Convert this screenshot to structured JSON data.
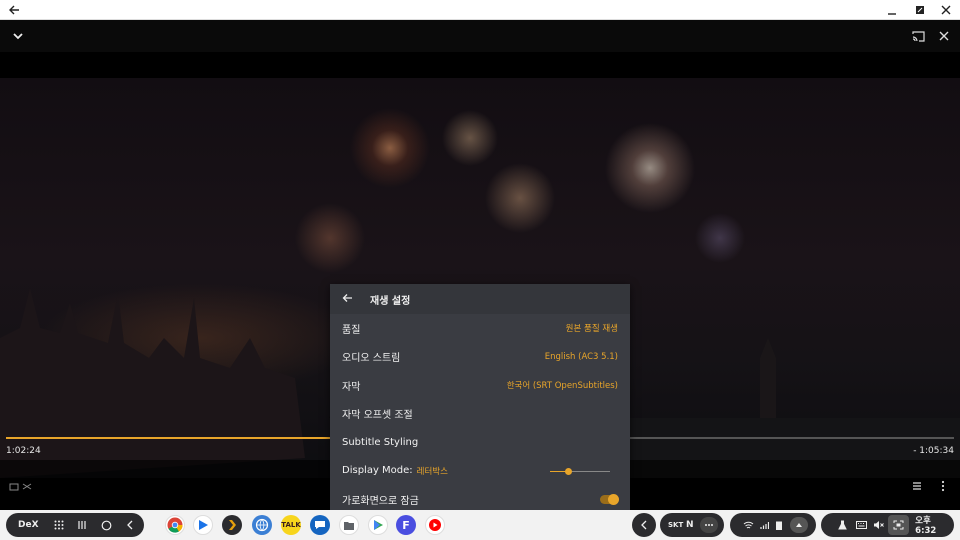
{
  "window": {
    "back_icon": "arrow-left-icon",
    "minimize_icon": "minimize-icon",
    "resize_icon": "resize-icon",
    "close_icon": "close-icon"
  },
  "player": {
    "collapse_icon": "chevron-down-icon",
    "cast_icon": "cast-icon",
    "close_icon": "close-icon",
    "elapsed": "1:02:24",
    "remaining": "- 1:05:34",
    "progress": 0.49,
    "accent": "#e8a52a"
  },
  "settings": {
    "title": "재생 설정",
    "rows": [
      {
        "label": "품질",
        "value": "원본 품질 재생"
      },
      {
        "label": "오디오 스트림",
        "value": "English (AC3 5.1)"
      },
      {
        "label": "자막",
        "value": "한국어 (SRT OpenSubtitles)"
      },
      {
        "label": "자막 오프셋 조절",
        "value": ""
      },
      {
        "label": "Subtitle Styling",
        "value": ""
      },
      {
        "label": "Display Mode:",
        "value": "레터박스"
      },
      {
        "label": "가로화면으로 잠금",
        "value": ""
      }
    ],
    "display_mode_level": 0.3,
    "landscape_lock": true
  },
  "taskbar": {
    "dex_label": "DeX",
    "carrier": "SKT",
    "carrier_n": "N",
    "clock": "오후 6:32",
    "apps": [
      {
        "name": "chrome-app",
        "label": ""
      },
      {
        "name": "play-store-app",
        "label": ""
      },
      {
        "name": "plex-app",
        "label": ""
      },
      {
        "name": "browser-app",
        "label": ""
      },
      {
        "name": "kakaotalk-app",
        "label": "TALK"
      },
      {
        "name": "messages-app",
        "label": ""
      },
      {
        "name": "files-app",
        "label": ""
      },
      {
        "name": "google-play-app",
        "label": ""
      },
      {
        "name": "f-app",
        "label": "F"
      },
      {
        "name": "youtube-music-app",
        "label": ""
      }
    ]
  }
}
